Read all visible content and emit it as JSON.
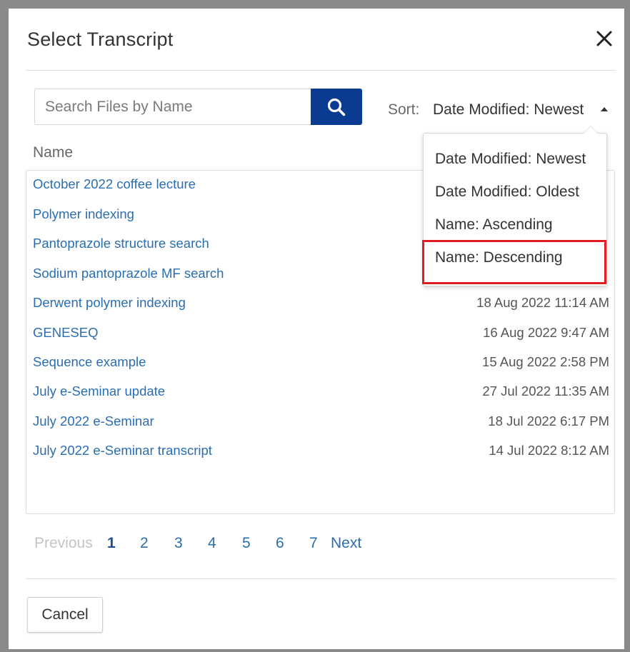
{
  "dialog": {
    "title": "Select Transcript",
    "close_icon": "close-icon"
  },
  "search": {
    "placeholder": "Search Files by Name",
    "value": "",
    "button_icon": "search-icon"
  },
  "sort": {
    "label": "Sort:",
    "selected": "Date Modified: Newest",
    "options": [
      "Date Modified: Newest",
      "Date Modified: Oldest",
      "Name: Ascending",
      "Name: Descending"
    ],
    "highlighted_option": "Name: Descending",
    "highlight_color": "#e01b22"
  },
  "list": {
    "column_name": "Name",
    "rows": [
      {
        "name": "October 2022 coffee lecture",
        "date": ""
      },
      {
        "name": "Polymer indexing",
        "date": ""
      },
      {
        "name": "Pantoprazole structure search",
        "date": ""
      },
      {
        "name": "Sodium pantoprazole MF search",
        "date": ""
      },
      {
        "name": "Derwent polymer indexing",
        "date": "18 Aug 2022 11:14 AM"
      },
      {
        "name": "GENESEQ",
        "date": "16 Aug 2022 9:47 AM"
      },
      {
        "name": "Sequence example",
        "date": "15 Aug 2022 2:58 PM"
      },
      {
        "name": "July e-Seminar update",
        "date": "27 Jul 2022 11:35 AM"
      },
      {
        "name": "July 2022 e-Seminar",
        "date": "18 Jul 2022 6:17 PM"
      },
      {
        "name": "July 2022 e-Seminar transcript",
        "date": "14 Jul 2022 8:12 AM"
      }
    ]
  },
  "pagination": {
    "previous": "Previous",
    "pages": [
      "1",
      "2",
      "3",
      "4",
      "5",
      "6",
      "7"
    ],
    "current": "1",
    "next": "Next"
  },
  "footer": {
    "cancel_label": "Cancel"
  },
  "colors": {
    "primary_button": "#0b3a91",
    "link": "#2a6eb1"
  }
}
